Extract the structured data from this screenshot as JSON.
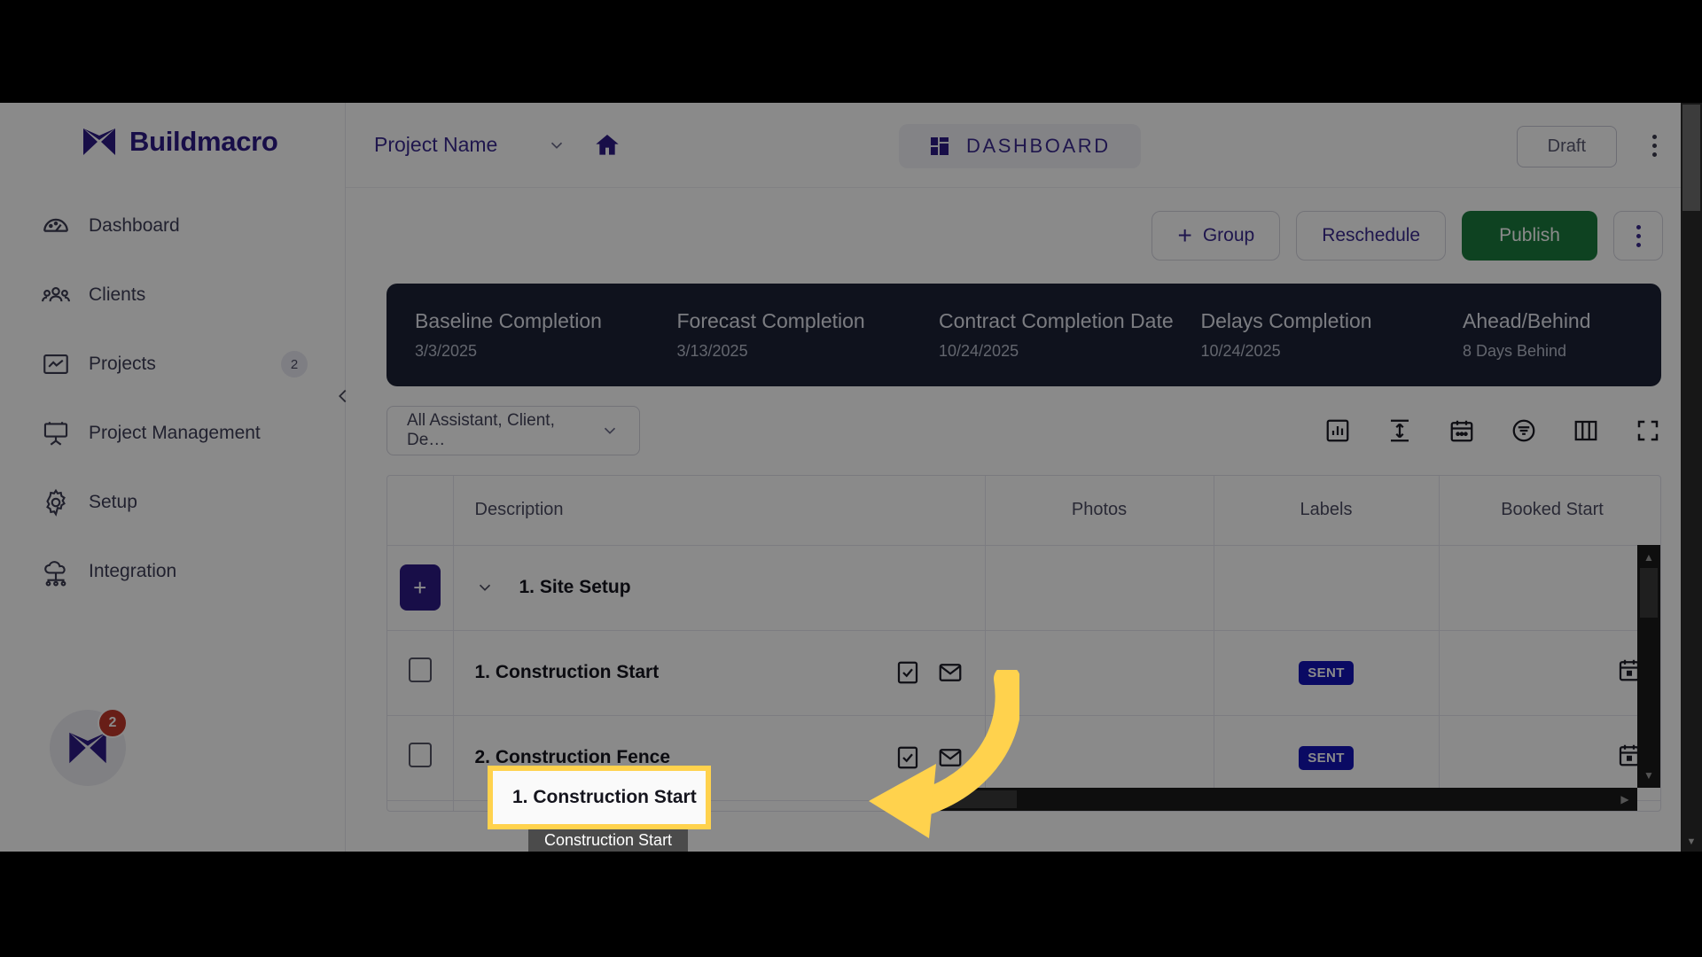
{
  "brand": {
    "name": "Buildmacro",
    "logo_icon": "buildmacro-logo-icon"
  },
  "sidebar": {
    "items": [
      {
        "label": "Dashboard",
        "icon": "speedometer-icon",
        "badge": ""
      },
      {
        "label": "Clients",
        "icon": "people-group-icon",
        "badge": ""
      },
      {
        "label": "Projects",
        "icon": "chart-box-icon",
        "badge": "2"
      },
      {
        "label": "Project Management",
        "icon": "easel-board-icon",
        "badge": ""
      },
      {
        "label": "Setup",
        "icon": "gear-icon",
        "badge": ""
      },
      {
        "label": "Integration",
        "icon": "cloud-network-icon",
        "badge": ""
      }
    ],
    "avatar": {
      "icon": "buildmacro-logo-icon",
      "badge": "2"
    },
    "collapse_icon": "chevron-left-icon"
  },
  "header": {
    "project_selector": {
      "value": "Project Name",
      "chevron_icon": "chevron-down-icon"
    },
    "home_icon": "home-icon",
    "active_tab": {
      "label": "DASHBOARD",
      "icon": "dashboard-grid-icon"
    },
    "draft_label": "Draft",
    "kebab_icon": "more-vertical-icon"
  },
  "actions": {
    "group_label": "Group",
    "group_plus_icon": "plus-icon",
    "reschedule_label": "Reschedule",
    "publish_label": "Publish",
    "more_icon": "more-vertical-icon",
    "publish_color": "#1b7a3d"
  },
  "stats": [
    {
      "label": "Baseline Completion",
      "value": "3/3/2025"
    },
    {
      "label": "Forecast Completion",
      "value": "3/13/2025"
    },
    {
      "label": "Contract Completion Date",
      "value": "10/24/2025"
    },
    {
      "label": "Delays Completion",
      "value": "10/24/2025"
    },
    {
      "label": "Ahead/Behind",
      "value": "8 Days Behind"
    }
  ],
  "stats_bg": "#1c2236",
  "filter": {
    "selected": "All Assistant, Client, De…",
    "chevron_icon": "chevron-down-icon"
  },
  "toolbar_icons": [
    "bar-chart-icon",
    "row-height-icon",
    "calendar-icon",
    "filter-circle-icon",
    "columns-icon",
    "fullscreen-icon"
  ],
  "table": {
    "columns": [
      "",
      "Description",
      "Photos",
      "Labels",
      "Booked Start"
    ],
    "group": {
      "add_icon": "plus-icon",
      "chevron_icon": "chevron-down-icon",
      "title": "1. Site Setup"
    },
    "rows": [
      {
        "checkbox_icon": "checkbox-empty-icon",
        "description": "1. Construction Start",
        "icons": [
          "checklist-icon",
          "envelope-icon"
        ],
        "photos": "",
        "label_badge": "SENT",
        "booked_start_icon": "calendar-icon"
      },
      {
        "checkbox_icon": "checkbox-empty-icon",
        "description": "2. Construction Fence",
        "icons": [
          "checklist-icon",
          "envelope-icon"
        ],
        "photos": "",
        "label_badge": "SENT",
        "booked_start_icon": "calendar-icon"
      }
    ],
    "badge_color": "#1313b8"
  },
  "annotation": {
    "highlight_text": "1. Construction Start",
    "highlight_color": "#ffd24d",
    "tooltip_text": "Construction Start",
    "arrow_icon": "curved-arrow-left-icon"
  }
}
